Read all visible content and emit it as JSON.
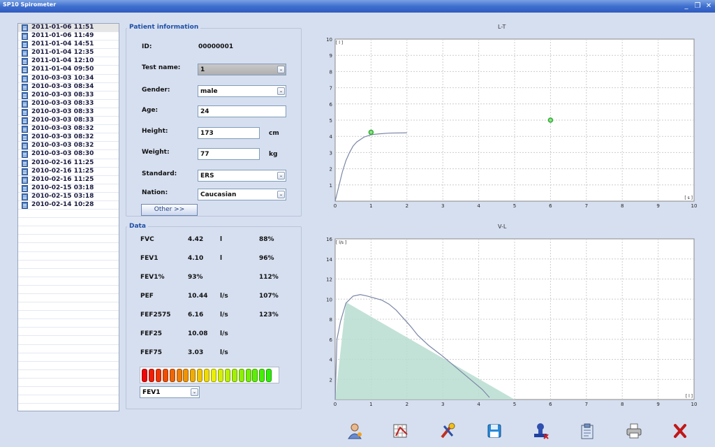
{
  "window": {
    "title": "SP10 Spirometer"
  },
  "sessions": [
    "2011-01-06 11:51",
    "2011-01-06 11:49",
    "2011-01-04 14:51",
    "2011-01-04 12:35",
    "2011-01-04 12:10",
    "2011-01-04 09:50",
    "2010-03-03 10:34",
    "2010-03-03 08:34",
    "2010-03-03 08:33",
    "2010-03-03 08:33",
    "2010-03-03 08:33",
    "2010-03-03 08:33",
    "2010-03-03 08:32",
    "2010-03-03 08:32",
    "2010-03-03 08:32",
    "2010-03-03 08:30",
    "2010-02-16 11:25",
    "2010-02-16 11:25",
    "2010-02-16 11:25",
    "2010-02-15 03:18",
    "2010-02-15 03:18",
    "2010-02-14 10:28"
  ],
  "patient": {
    "section_title": "Patient information",
    "id_label": "ID:",
    "id_value": "00000001",
    "test_label": "Test name:",
    "test_value": "1",
    "gender_label": "Gender:",
    "gender_value": "male",
    "age_label": "Age:",
    "age_value": "24",
    "height_label": "Height:",
    "height_value": "173",
    "height_unit": "cm",
    "weight_label": "Weight:",
    "weight_value": "77",
    "weight_unit": "kg",
    "standard_label": "Standard:",
    "standard_value": "ERS",
    "nation_label": "Nation:",
    "nation_value": "Caucasian",
    "other_button": "Other >>"
  },
  "data_section": {
    "title": "Data",
    "rows": [
      {
        "name": "FVC",
        "value": "4.42",
        "unit": "l",
        "pct": "88%"
      },
      {
        "name": "FEV1",
        "value": "4.10",
        "unit": "l",
        "pct": "96%"
      },
      {
        "name": "FEV1%",
        "value": "93%",
        "unit": "",
        "pct": "112%"
      },
      {
        "name": "PEF",
        "value": "10.44",
        "unit": "l/s",
        "pct": "107%"
      },
      {
        "name": "FEF2575",
        "value": "6.16",
        "unit": "l/s",
        "pct": "123%"
      },
      {
        "name": "FEF25",
        "value": "10.08",
        "unit": "l/s",
        "pct": ""
      },
      {
        "name": "FEF75",
        "value": "3.03",
        "unit": "l/s",
        "pct": ""
      }
    ],
    "gauge_filled_segments": 19,
    "gauge_total_segments": 19,
    "gauge_select": "FEV1"
  },
  "chart_data": [
    {
      "type": "line",
      "title": "L-T",
      "xlabel": "[ s ]",
      "ylabel": "[ l ]",
      "xlim": [
        0,
        10
      ],
      "ylim": [
        0,
        10
      ],
      "x_ticks": [
        0,
        1,
        2,
        3,
        4,
        5,
        6,
        7,
        8,
        9,
        10
      ],
      "y_ticks": [
        1,
        2,
        3,
        4,
        5,
        6,
        7,
        8,
        9,
        10
      ],
      "grid": true,
      "curve": {
        "x": [
          0,
          0.1,
          0.2,
          0.3,
          0.4,
          0.5,
          0.6,
          0.8,
          1.0,
          1.2,
          1.5,
          2.0
        ],
        "y": [
          0,
          0.9,
          1.8,
          2.5,
          3.0,
          3.4,
          3.65,
          3.95,
          4.1,
          4.15,
          4.2,
          4.22
        ]
      },
      "markers": [
        {
          "x": 1.0,
          "y": 4.25
        },
        {
          "x": 6.0,
          "y": 5.0
        }
      ]
    },
    {
      "type": "area",
      "title": "V-L",
      "xlabel": "[ l ]",
      "ylabel": "[ l/s ]",
      "xlim": [
        0,
        10
      ],
      "ylim": [
        0,
        16
      ],
      "x_ticks": [
        0,
        1,
        2,
        3,
        4,
        5,
        6,
        7,
        8,
        9,
        10
      ],
      "y_ticks": [
        2,
        4,
        6,
        8,
        10,
        12,
        14,
        16
      ],
      "grid": true,
      "predicted_area": {
        "x": [
          0,
          0.3,
          5.0
        ],
        "y": [
          0,
          9.7,
          0
        ]
      },
      "measured": {
        "x": [
          0,
          0.05,
          0.15,
          0.3,
          0.5,
          0.7,
          0.9,
          1.1,
          1.3,
          1.5,
          1.7,
          1.9,
          2.1,
          2.3,
          2.6,
          3.0,
          3.4,
          3.8,
          4.1,
          4.3
        ],
        "y": [
          0,
          6.0,
          7.8,
          9.6,
          10.3,
          10.45,
          10.3,
          10.1,
          9.9,
          9.5,
          8.9,
          8.1,
          7.3,
          6.4,
          5.4,
          4.3,
          3.1,
          1.9,
          1.0,
          0.2
        ]
      }
    }
  ],
  "toolbar": [
    {
      "icon": "patient-icon"
    },
    {
      "icon": "chart-edit-icon"
    },
    {
      "icon": "tools-icon"
    },
    {
      "icon": "save-icon"
    },
    {
      "icon": "stamp-icon"
    },
    {
      "icon": "clipboard-icon"
    },
    {
      "icon": "printer-icon"
    },
    {
      "icon": "exit-icon"
    }
  ]
}
